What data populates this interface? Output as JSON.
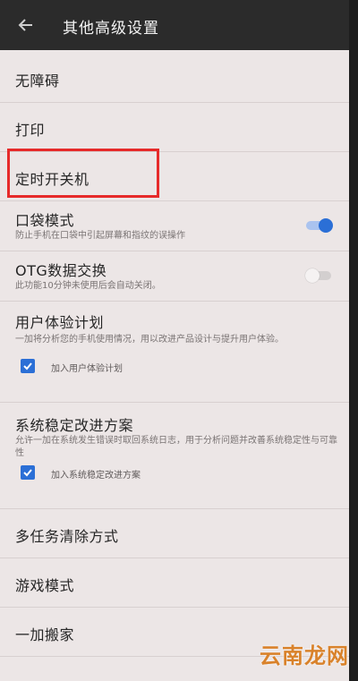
{
  "header": {
    "title": "其他高级设置",
    "back_icon": "arrow-left-icon"
  },
  "items": [
    {
      "label": "无障碍"
    },
    {
      "label": "打印"
    },
    {
      "label": "定时开关机"
    },
    {
      "label": "口袋模式",
      "desc": "防止手机在口袋中引起屏幕和指纹的误操作",
      "toggle": "on"
    },
    {
      "label": "OTG数据交换",
      "desc": "此功能10分钟未使用后会自动关闭。",
      "toggle": "off"
    },
    {
      "label": "用户体验计划",
      "desc": "一加将分析您的手机使用情况，用以改进产品设计与提升用户体验。",
      "checkbox_label": "加入用户体验计划",
      "checked": true
    },
    {
      "label": "系统稳定改进方案",
      "desc": "允许一加在系统发生错误时取回系统日志，用于分析问题并改善系统稳定性与可靠性",
      "checkbox_label": "加入系统稳定改进方案",
      "checked": true
    },
    {
      "label": "多任务清除方式"
    },
    {
      "label": "游戏模式"
    },
    {
      "label": "一加搬家"
    }
  ],
  "watermark": "云南龙网",
  "colors": {
    "accent": "#2b6fd6",
    "highlight": "#e62a2a",
    "background": "#ece6e6",
    "appbar": "#2b2b2b"
  }
}
